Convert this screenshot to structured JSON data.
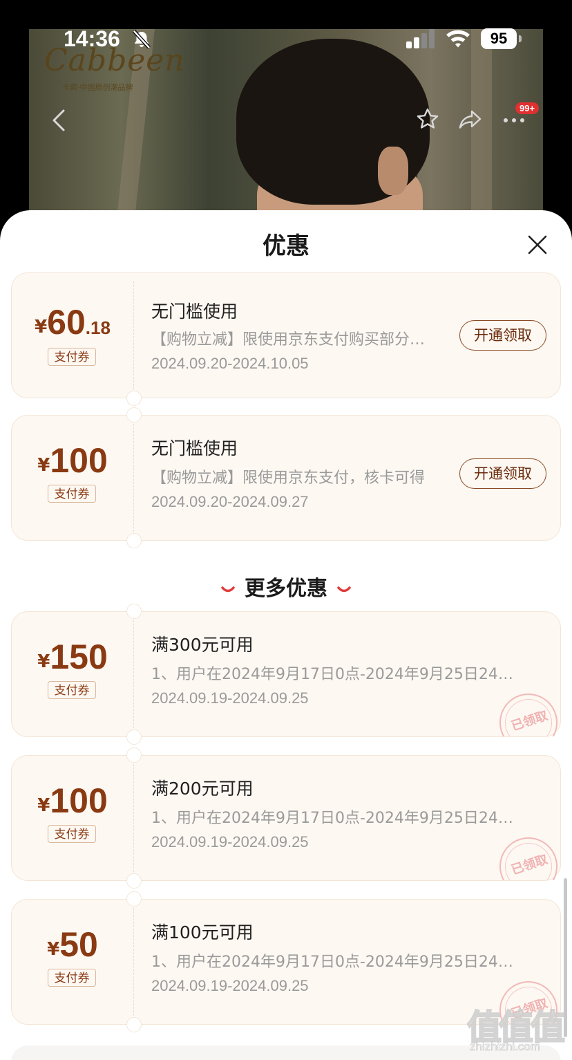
{
  "status_bar": {
    "time": "14:36",
    "battery": "95"
  },
  "nav": {
    "badge": "99+"
  },
  "brand": {
    "logo_text": "Cabbeen",
    "logo_subtitle": "卡宾·中国原创潮品牌"
  },
  "sheet": {
    "title": "优惠"
  },
  "coupons": [
    {
      "currency": "¥",
      "amount_int": "60",
      "amount_dec": ".18",
      "tag": "支付券",
      "title": "无门槛使用",
      "desc": "【购物立减】限使用京东支付购买部分…",
      "date": "2024.09.20-2024.10.05",
      "action": "开通领取"
    },
    {
      "currency": "¥",
      "amount_int": "100",
      "amount_dec": "",
      "tag": "支付券",
      "title": "无门槛使用",
      "desc": "【购物立减】限使用京东支付，核卡可得",
      "date": "2024.09.20-2024.09.27",
      "action": "开通领取"
    }
  ],
  "more_section": {
    "title": "更多优惠"
  },
  "more_coupons": [
    {
      "currency": "¥",
      "amount_int": "150",
      "tag": "支付券",
      "title": "满300元可用",
      "desc": "1、用户在2024年9月17日0点-2024年9月25日24…",
      "date": "2024.09.19-2024.09.25",
      "stamp": "已领取"
    },
    {
      "currency": "¥",
      "amount_int": "100",
      "tag": "支付券",
      "title": "满200元可用",
      "desc": "1、用户在2024年9月17日0点-2024年9月25日24…",
      "date": "2024.09.19-2024.09.25",
      "stamp": "已领取"
    },
    {
      "currency": "¥",
      "amount_int": "50",
      "tag": "支付券",
      "title": "满100元可用",
      "desc": "1、用户在2024年9月17日0点-2024年9月25日24…",
      "date": "2024.09.19-2024.09.25",
      "stamp": "已领取"
    }
  ],
  "watermark": {
    "chars": "值值值",
    "url": "zhizhizhi.com"
  },
  "icons": [
    "bell-muted-icon",
    "signal-icon",
    "wifi-icon",
    "back-icon",
    "star-icon",
    "share-icon",
    "more-icon",
    "close-icon",
    "smile-icon"
  ],
  "colors": {
    "accent": "#8a3a12",
    "coupon_bg": "#fdf8f2",
    "badge": "#e03030",
    "smile": "#e03a3a"
  }
}
